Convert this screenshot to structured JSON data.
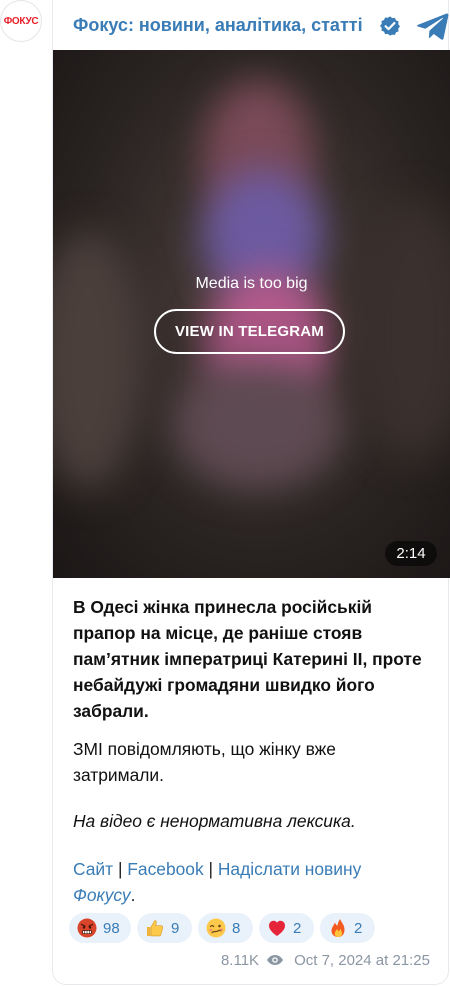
{
  "channel": {
    "avatar_text": "ФОКУС",
    "name": "Фокус: новини, аналітика, статті",
    "verified_icon": "verified-badge-icon",
    "telegram_icon": "telegram-icon"
  },
  "video": {
    "overlay_label": "Media is too big",
    "button_label": "VIEW IN TELEGRAM",
    "duration": "2:14"
  },
  "post": {
    "paragraph1": "В Одесі жінка принесла російській прапор на місце, де раніше стояв пам’ятник імператриці Катерині ІІ, проте небайдужі громадяни швидко його забрали.",
    "paragraph2": "ЗМІ повідомляють, що жінку вже затримали.",
    "paragraph3": "На відео є ненормативна лексика.",
    "links": {
      "site": "Сайт",
      "sep1": " | ",
      "facebook": "Facebook",
      "sep2": " | ",
      "send_news": "Надіслати новину",
      "fokusu": "Фокусу",
      "period": "."
    }
  },
  "reactions": [
    {
      "icon": "angry-face-icon",
      "count": "98"
    },
    {
      "icon": "thumbs-up-icon",
      "count": "9"
    },
    {
      "icon": "woozy-face-icon",
      "count": "8"
    },
    {
      "icon": "heart-icon",
      "count": "2"
    },
    {
      "icon": "fire-icon",
      "count": "2"
    }
  ],
  "footer": {
    "views": "8.11K",
    "timestamp": "Oct 7, 2024 at 21:25"
  },
  "colors": {
    "accent": "#3a7cb6",
    "reaction_bg": "#e9f1fb",
    "brand_red": "#e8202a",
    "muted": "#8b96a3"
  }
}
